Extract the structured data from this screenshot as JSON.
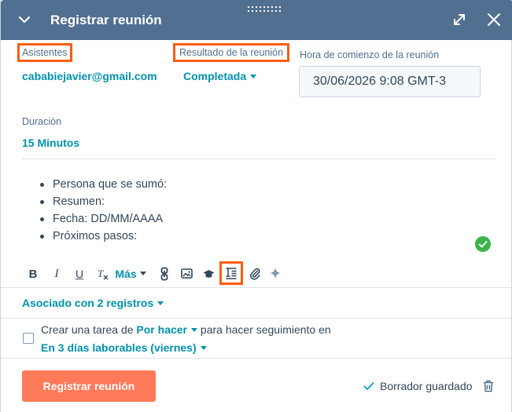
{
  "header": {
    "title": "Registrar reunión",
    "color": "#516f90"
  },
  "fields": {
    "attendees": {
      "label": "Asistentes",
      "value": "cababiejavier@gmail.com"
    },
    "outcome": {
      "label": "Resultado de la reunión",
      "value": "Completada"
    },
    "start_time": {
      "label": "Hora de comienzo de la reunión",
      "value": "30/06/2026 9:08 GMT-3"
    },
    "duration": {
      "label": "Duración",
      "value": "15 Minutos"
    }
  },
  "notes": {
    "items": [
      "Persona que se sumó:",
      "Resumen:",
      "Fecha: DD/MM/AAAA",
      "Próximos pasos:"
    ]
  },
  "toolbar": {
    "bold": "B",
    "italic": "I",
    "underline": "U",
    "more": "Más"
  },
  "association": {
    "label": "Asociado con 2 registros"
  },
  "task": {
    "prefix": "Crear una tarea de",
    "type": "Por hacer",
    "suffix": "para hacer seguimiento en",
    "due": "En 3 días laborables (viernes)"
  },
  "footer": {
    "submit_label": "Registrar reunión",
    "draft_status": "Borrador guardado",
    "submit_color": "#ff7a59"
  },
  "colors": {
    "accent": "#0091ae",
    "highlight": "#ff5c10",
    "success": "#3bb54a"
  }
}
